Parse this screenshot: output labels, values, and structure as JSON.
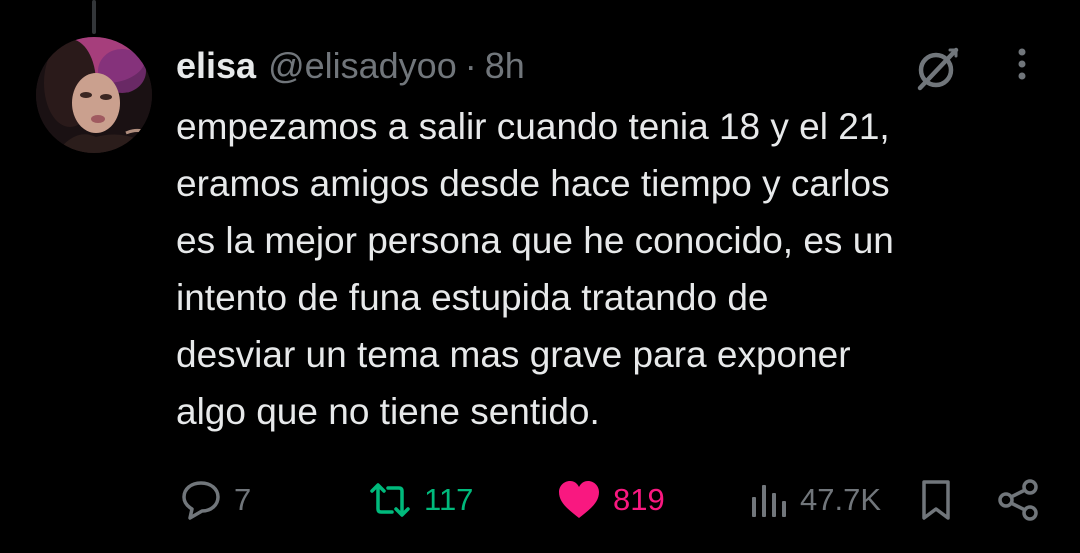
{
  "tweet": {
    "display_name": "elisa",
    "handle": "@elisadyoo",
    "separator": "·",
    "time": "8h",
    "text_lines": [
      "empezamos a salir cuando tenia 18 y el 21,",
      "eramos amigos desde hace tiempo y carlos",
      "es la mejor persona que he conocido, es un",
      "intento de funa estupida tratando de",
      "desviar un tema mas grave para exponer",
      "algo que no tiene sentido."
    ]
  },
  "actions": {
    "replies": "7",
    "retweets": "117",
    "likes": "819",
    "views": "47.7K"
  },
  "icons": {
    "header": [
      "grok-icon",
      "more-icon"
    ],
    "actions": [
      "reply-icon",
      "retweet-icon",
      "like-icon",
      "views-icon",
      "bookmark-icon",
      "share-icon"
    ]
  },
  "colors": {
    "background": "#000000",
    "text": "#e7e9ea",
    "muted": "#71767b",
    "retweet": "#00ba7c",
    "like": "#f91880",
    "thread_line": "#333639"
  }
}
